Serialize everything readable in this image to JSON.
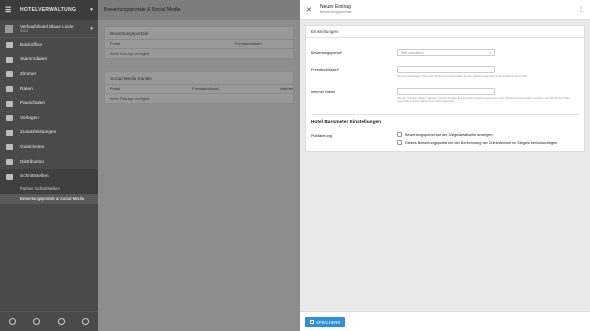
{
  "sidebar": {
    "app_title": "HOTELVERWALTUNG",
    "hotel": {
      "name": "Verkaufshotel Blaue Linde",
      "sub": "5503"
    },
    "items": [
      {
        "label": "Backoffice",
        "icon": "briefcase-icon"
      },
      {
        "label": "Stammdaten",
        "icon": "clipboard-icon"
      },
      {
        "label": "Zimmer",
        "icon": "bed-icon"
      },
      {
        "label": "Raten",
        "icon": "money-icon"
      },
      {
        "label": "Pauschalen",
        "icon": "tag-icon"
      },
      {
        "label": "Vorlagen",
        "icon": "folder-icon"
      },
      {
        "label": "Zusatzleistungen",
        "icon": "hand-icon"
      },
      {
        "label": "Gutscheine",
        "icon": "gift-icon"
      },
      {
        "label": "Distribution",
        "icon": "share-icon"
      },
      {
        "label": "Schnittstellen",
        "icon": "plug-icon"
      }
    ],
    "subitems": [
      "Partner Schnittstellen",
      "Bewertungsportale & Social Media"
    ]
  },
  "main": {
    "title": "Bewertungsportale & Social Media",
    "panels": [
      {
        "title": "Bewertungsportale",
        "cols": [
          "Portal",
          "Fremdschlüssel"
        ],
        "empty": "Keine Einträge verfügbar"
      },
      {
        "title": "Social Media Kanäle",
        "cols": [
          "Portal",
          "Fremdschlüssel",
          "Interner"
        ],
        "empty": "Keine Einträge verfügbar"
      }
    ]
  },
  "drawer": {
    "title": "Neuer Eintrag",
    "subtitle": "Bewertungsportale",
    "card_title": "Einstellungen",
    "fields": {
      "portal_label": "Bewertungsportal*",
      "portal_placeholder": "Bitte auswählen",
      "key_label": "Fremdschlüssel*",
      "key_help": "Der Fremdschlüssel (Token oder ähnlich) ist bei Bestellen auf dem Bewertungsportal ist als Hotelkennung im URL",
      "name_label": "Interner Name",
      "name_help": "Wie der \"Internen Namen\" aktiviert möchten Quellen des gewählten Bewertungsportals in der Übersicht unterscheiden möchten, wird bei der DIY PRO verwendet und beim Bezeichnen nicht angezeigt)"
    },
    "barometer": {
      "title": "Hotel Barometer Einstellungen",
      "label": "Publizierung",
      "opt1": "Bewertungsportal auf der Siegeldetailseite anzeigen",
      "opt2": "Dieses Bewertungsportal bei der Berechnung der Zufriedenheit im Siegels berücksichtigen"
    },
    "save_label": "SPEICHERN"
  }
}
